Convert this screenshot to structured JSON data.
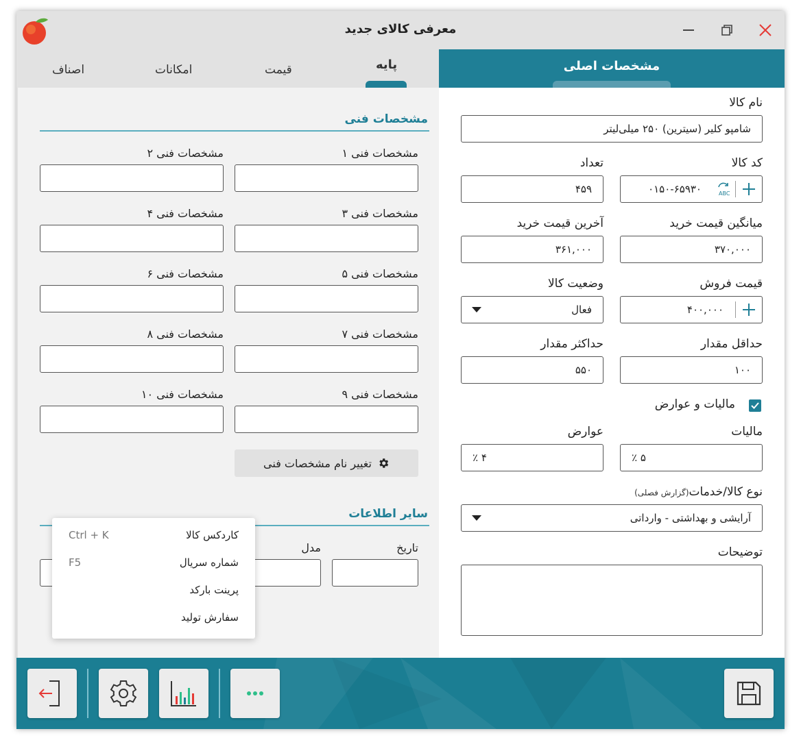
{
  "window": {
    "title": "معرفی کالای جدید",
    "icons": {
      "logo": "peach-logo-icon",
      "minimize": "minimize-icon",
      "maximize": "restore-icon",
      "close": "close-icon"
    },
    "close_color": "#e53935"
  },
  "tabs": [
    {
      "label": "پایه",
      "active": true
    },
    {
      "label": "قیمت",
      "active": false
    },
    {
      "label": "امکانات",
      "active": false
    },
    {
      "label": "اصناف",
      "active": false
    }
  ],
  "left": {
    "tech_section_title": "مشخصات فنی",
    "tech_specs": [
      {
        "label": "مشخصات فنی ۱",
        "value": ""
      },
      {
        "label": "مشخصات فنی ۲",
        "value": ""
      },
      {
        "label": "مشخصات فنی ۳",
        "value": ""
      },
      {
        "label": "مشخصات فنی ۴",
        "value": ""
      },
      {
        "label": "مشخصات فنی ۵",
        "value": ""
      },
      {
        "label": "مشخصات فنی ۶",
        "value": ""
      },
      {
        "label": "مشخصات فنی ۷",
        "value": ""
      },
      {
        "label": "مشخصات فنی ۸",
        "value": ""
      },
      {
        "label": "مشخصات فنی ۹",
        "value": ""
      },
      {
        "label": "مشخصات فنی ۱۰",
        "value": ""
      }
    ],
    "rename_button": "تغییر نام مشخصات فنی",
    "rename_icon": "gear-icon",
    "other_section_title": "سایر اطلاعات",
    "date_label": "تاریخ",
    "model_label": "مدل"
  },
  "context_menu": [
    {
      "label": "کاردکس کالا",
      "shortcut": "Ctrl + K"
    },
    {
      "label": "شماره سریال",
      "shortcut": "F5"
    },
    {
      "label": "پرینت بارکد",
      "shortcut": ""
    },
    {
      "label": "سفارش تولید",
      "shortcut": ""
    }
  ],
  "right": {
    "header_title": "مشخصات اصلی",
    "name_label": "نام کالا",
    "name_value": "شامپو کلیر (سیترین) ۲۵۰ میلی‌لیتر",
    "code_label": "کد کالا",
    "code_value": "۰۱۵۰-۶۵۹۳۰",
    "qty_label": "تعداد",
    "qty_value": "۴۵۹",
    "avg_price_label": "میانگین قیمت خرید",
    "avg_price_value": "۳۷۰,۰۰۰",
    "last_price_label": "آخرین قیمت خرید",
    "last_price_value": "۳۶۱,۰۰۰",
    "sell_price_label": "قیمت فروش",
    "sell_price_value": "۴۰۰,۰۰۰",
    "status_label": "وضعیت کالا",
    "status_value": "فعال",
    "min_label": "حداقل مقدار",
    "min_value": "۱۰۰",
    "max_label": "حداکثر مقدار",
    "max_value": "۵۵۰",
    "tax_toggle_label": "مالیات و عوارض",
    "tax_toggle_checked": true,
    "tax_label": "مالیات",
    "tax_value": "٪ ۵",
    "duty_label": "عوارض",
    "duty_value": "٪ ۴",
    "type_label": "نوع کالا/خدمات",
    "type_note": "(گزارش فصلی)",
    "type_value": "آرایشی و بهداشتی - وارداتی",
    "desc_label": "توضیحات",
    "desc_value": ""
  },
  "toolbar": {
    "buttons": [
      "exit-icon",
      "settings-gear-icon",
      "bar-chart-icon",
      "more-dots-icon",
      "save-floppy-icon"
    ]
  },
  "colors": {
    "accent": "#1f7f96",
    "plus": "#1f7f96",
    "exit_arrow": "#e53935",
    "dots": "#2ebf8a"
  }
}
